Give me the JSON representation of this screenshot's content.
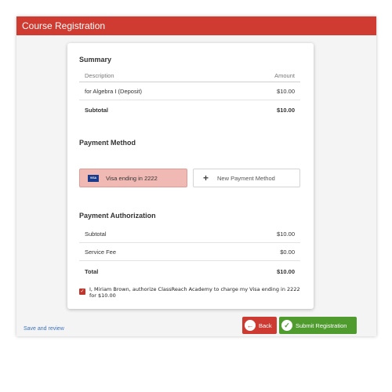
{
  "window": {
    "title": "Course Registration"
  },
  "summary": {
    "title": "Summary",
    "columns": {
      "description": "Description",
      "amount": "Amount"
    },
    "item": {
      "description": "for Algebra I (Deposit)",
      "amount": "$10.00"
    },
    "subtotal": {
      "label": "Subtotal",
      "amount": "$10.00"
    }
  },
  "payment_method": {
    "title": "Payment Method",
    "selected": {
      "label": "Visa ending in 2222",
      "brand": "VISA"
    },
    "new_label": "New Payment Method",
    "new_icon": "+"
  },
  "authorization": {
    "title": "Payment Authorization",
    "subtotal": {
      "label": "Subtotal",
      "amount": "$10.00"
    },
    "service_fee": {
      "label": "Service Fee",
      "amount": "$0.00"
    },
    "total": {
      "label": "Total",
      "amount": "$10.00"
    },
    "checkbox_checked": true,
    "check_glyph": "✓",
    "agreement": "I, Miriam Brown, authorize ClassReach Academy to charge my Visa ending in 2222 for $10.00"
  },
  "footer": {
    "save_link": "Save and review",
    "back_label": "Back",
    "back_icon": "←",
    "submit_label": "Submit Registration",
    "submit_icon": "✓"
  },
  "colors": {
    "accent": "#cf3b30",
    "selected_fill": "#f0b9b3",
    "success": "#4f9b2e",
    "link": "#3b73c4"
  }
}
